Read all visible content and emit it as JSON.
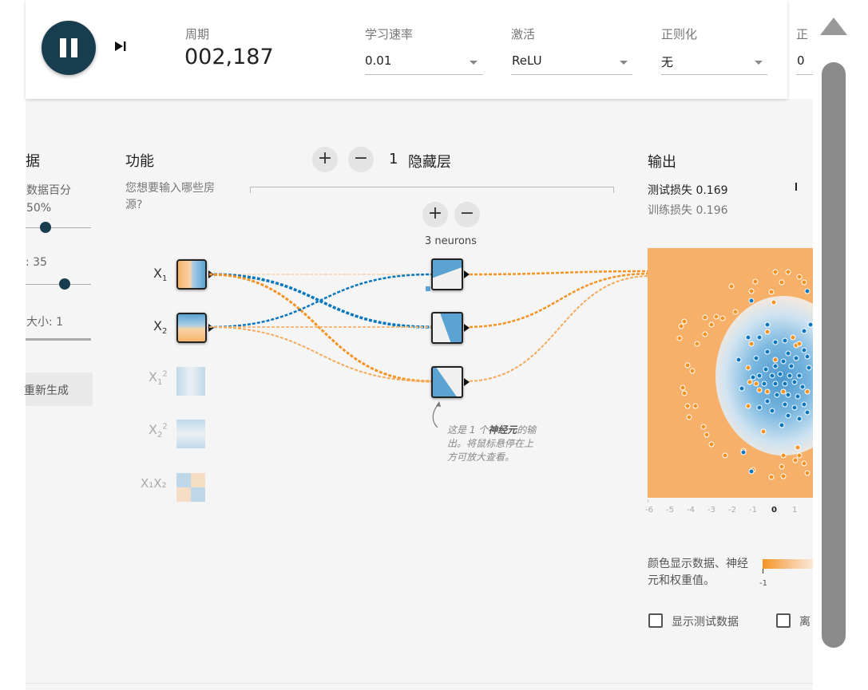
{
  "toolbar": {
    "epoch_label": "周期",
    "epoch_value": "002,187",
    "learning_rate": {
      "label": "学习速率",
      "value": "0.01"
    },
    "activation": {
      "label": "激活",
      "value": "ReLU"
    },
    "regularization": {
      "label": "正则化",
      "value": "无"
    },
    "reg_rate": {
      "label": "正",
      "value": "0"
    }
  },
  "data_panel": {
    "title_fragment": "据",
    "ratio_label": "数据百分",
    "ratio_value": "50%",
    "noise_value": ": 35",
    "batch_label": "大小: 1",
    "regenerate_label": "重新生成",
    "ratio_level": 0.5,
    "noise_level": 0.7
  },
  "features": {
    "title": "功能",
    "subtitle": "您想要输入哪些房源?",
    "items": [
      {
        "label": "X",
        "sub": "1",
        "sup": "",
        "active": true
      },
      {
        "label": "X",
        "sub": "2",
        "sup": "",
        "active": true
      },
      {
        "label": "X",
        "sub": "1",
        "sup": "2",
        "active": false
      },
      {
        "label": "X",
        "sub": "2",
        "sup": "2",
        "active": false
      },
      {
        "label": "X₁X₂",
        "sub": "",
        "sup": "",
        "active": false
      }
    ]
  },
  "network": {
    "layer_count": "1",
    "hidden_layers_label": "隐藏层",
    "add_layer": "+",
    "remove_layer": "−",
    "add_neuron": "+",
    "remove_neuron": "−",
    "neuron_count_label": "3 neurons",
    "callout_line1_pre": "这是 1 个",
    "callout_line1_bold": "神经元",
    "callout_line1_post": "的",
    "callout_rest": "输出。将鼠标悬停在上方可放大查看。"
  },
  "output": {
    "title": "输出",
    "test_loss_label": "测试损失",
    "test_loss_value": "0.169",
    "train_loss_label": "训练损失",
    "train_loss_value": "0.196",
    "axis_ticks": [
      "-6",
      "-5",
      "-4",
      "-3",
      "-2",
      "-1",
      "0",
      "1"
    ],
    "legend_text": "颜色显示数据、神经元和权重值。",
    "legend_min": "-1",
    "show_test_label": "显示测试数据",
    "discretize_label": "离"
  },
  "colors": {
    "orange": "#f59322",
    "blue": "#0877bd",
    "dark_button": "#183d4e",
    "background": "#f5f5f5"
  },
  "icons": [
    "pause-icon",
    "step-icon",
    "caret-down-icon",
    "curved-arrow-icon",
    "scroll-up-icon"
  ]
}
